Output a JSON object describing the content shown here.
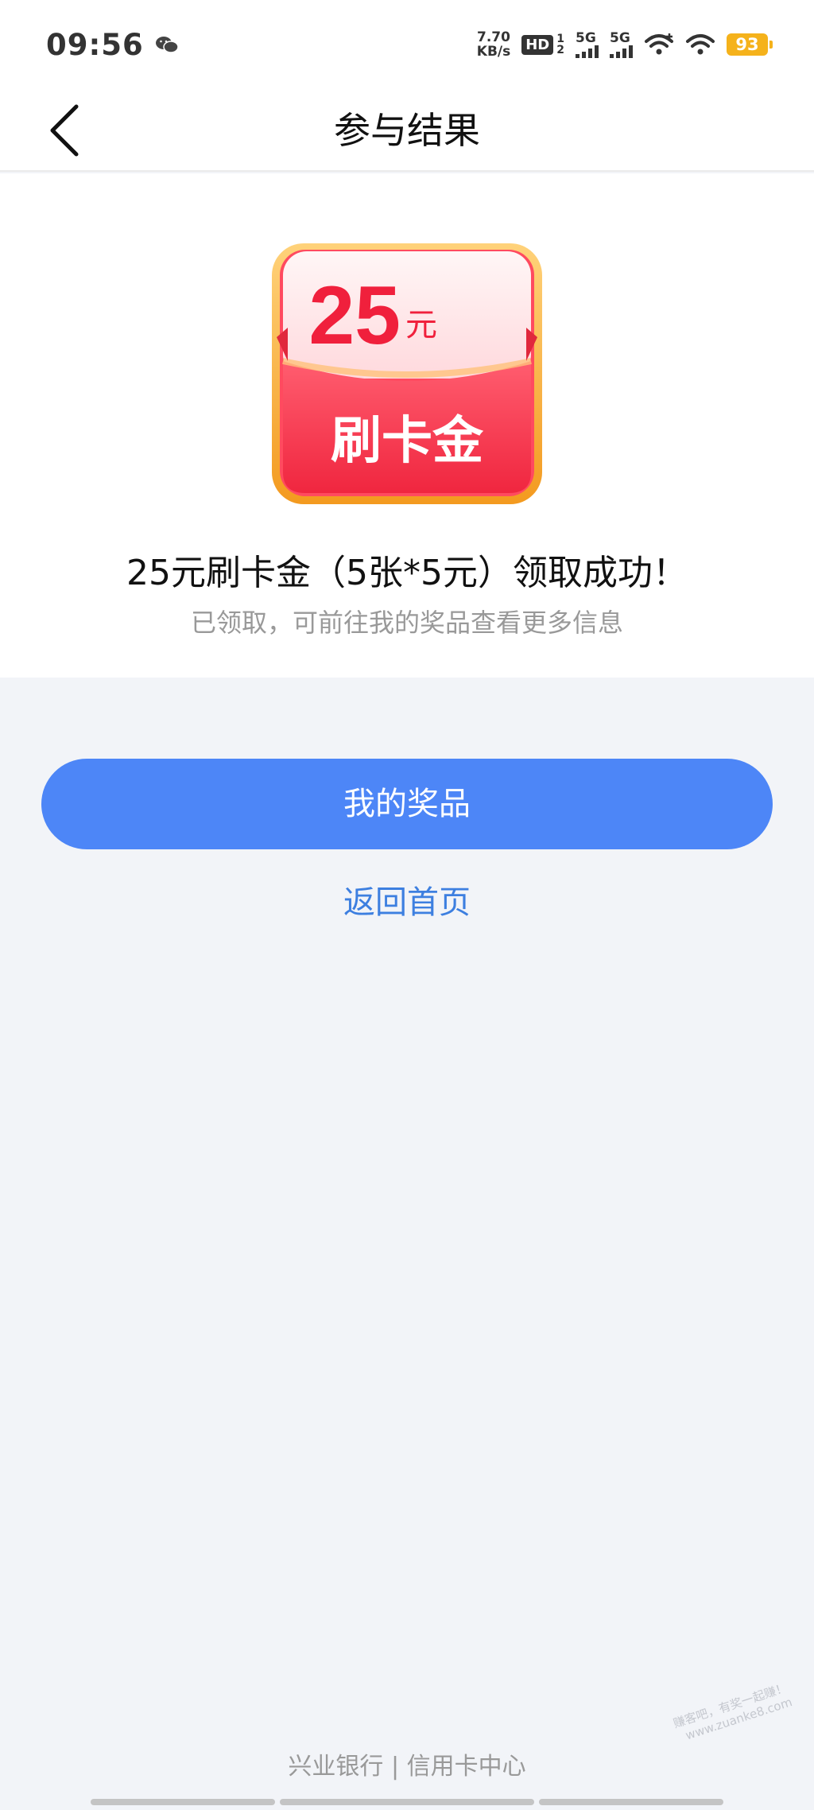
{
  "status_bar": {
    "time": "09:56",
    "speed_value": "7.70",
    "speed_unit": "KB/s",
    "hd": "HD",
    "sim_slots": [
      "1",
      "2"
    ],
    "network_1": "5G",
    "network_2": "5G",
    "battery": "93"
  },
  "nav": {
    "title": "参与结果"
  },
  "coupon": {
    "amount": "25",
    "unit": "元",
    "label": "刷卡金"
  },
  "result": {
    "title": "25元刷卡金（5张*5元）领取成功！",
    "subtitle": "已领取，可前往我的奖品查看更多信息"
  },
  "actions": {
    "primary": "我的奖品",
    "secondary": "返回首页"
  },
  "footer": {
    "text": "兴业银行 | 信用卡中心"
  },
  "watermark": {
    "line1": "赚客吧，有奖一起赚！",
    "line2": "www.zuanke8.com"
  },
  "colors": {
    "primary_button": "#4d86f7",
    "link": "#3d7fe0",
    "coupon_red": "#f53a55",
    "coupon_border": "#f7a531",
    "battery": "#f5b21b"
  }
}
